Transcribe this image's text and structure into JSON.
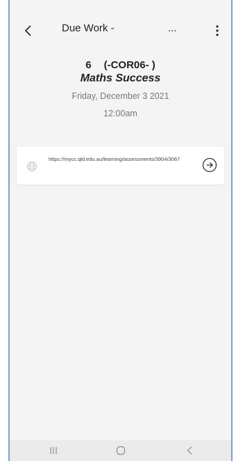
{
  "topbar": {
    "title": "Due Work -",
    "title_ellipsis": "...",
    "back_icon": "chevron-left-icon",
    "more_icon": "more-vertical-icon"
  },
  "header": {
    "course_number": "6",
    "course_code": "(-COR06- )",
    "subject": "Maths Success",
    "date": "Friday, December 3 2021",
    "time": "12:00am"
  },
  "link_card": {
    "url": "https://mycc.qld.edu.au/learning/assessments/3904/3067",
    "leading_icon": "globe-icon",
    "trailing_icon": "arrow-right-circle-icon"
  },
  "navbar": {
    "recents_icon": "recents-icon",
    "home_icon": "home-icon",
    "back_icon": "back-icon"
  },
  "colors": {
    "background": "#f4f4f4",
    "card": "#ffffff",
    "frame_border": "#7aa0d6",
    "navbar": "#ebebeb"
  }
}
